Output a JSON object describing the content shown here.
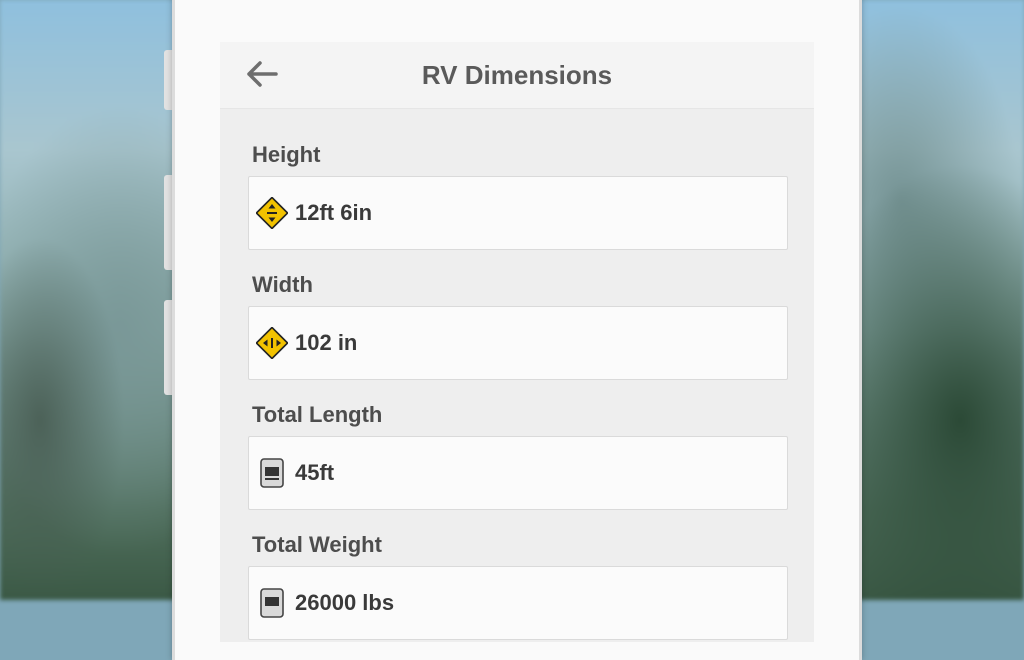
{
  "header": {
    "title": "RV Dimensions"
  },
  "fields": [
    {
      "label": "Height",
      "value": "12ft 6in",
      "icon": "height-warning-sign-icon",
      "icon_color": "#f2c200"
    },
    {
      "label": "Width",
      "value": "102 in",
      "icon": "width-warning-sign-icon",
      "icon_color": "#f2c200"
    },
    {
      "label": "Total Length",
      "value": "45ft",
      "icon": "length-sign-icon",
      "icon_color": "#d9d9d9"
    },
    {
      "label": "Total Weight",
      "value": "26000 lbs",
      "icon": "weight-sign-icon",
      "icon_color": "#d9d9d9"
    }
  ],
  "colors": {
    "accent_sign": "#f2c200",
    "text": "#3a3a3a",
    "label": "#4d4d4d"
  }
}
